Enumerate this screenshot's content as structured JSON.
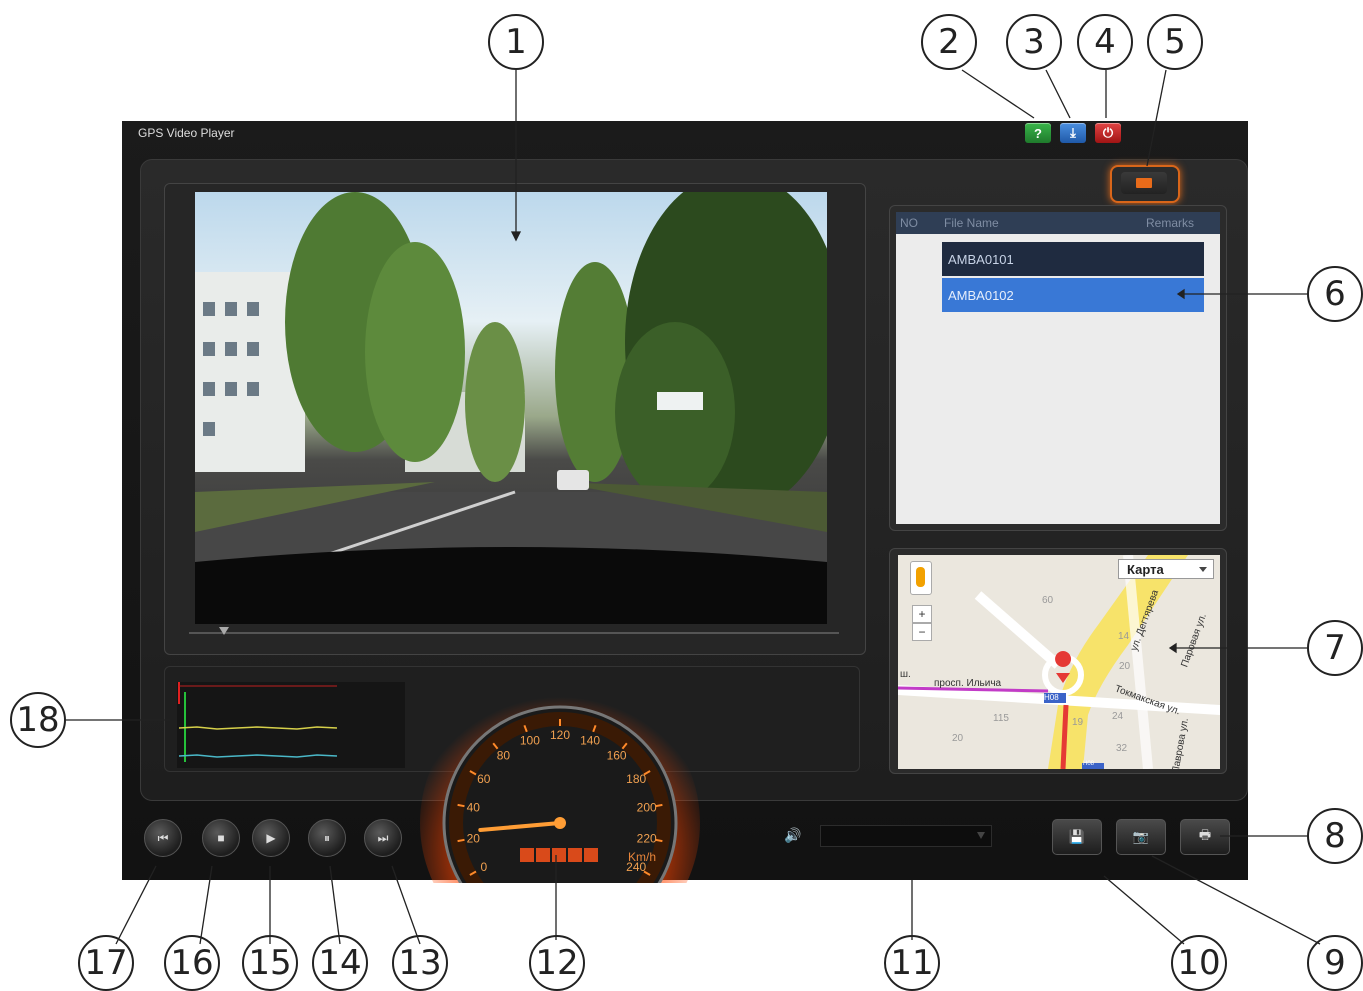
{
  "window": {
    "title": "GPS Video Player"
  },
  "window_buttons": {
    "help": "?",
    "download": "⤓",
    "power": "⏻"
  },
  "file_list": {
    "columns": [
      "NO",
      "File Name",
      "Remarks"
    ],
    "rows": [
      "AMBA0101",
      "AMBA0102"
    ],
    "selected_row": 1
  },
  "map": {
    "type_selector": "Карта",
    "zoom_in": "+",
    "zoom_out": "−",
    "labels": [
      "просп. Ильича",
      "Токмакская ул.",
      "ул. Дегтярева",
      "Лаврова ул.",
      "Паровая ул.",
      "ш."
    ],
    "numbers": [
      "115",
      "20",
      "19",
      "24",
      "32",
      "14",
      "20",
      "60"
    ],
    "route_badges": [
      "H08",
      "H08"
    ]
  },
  "speedometer": {
    "ticks": [
      "0",
      "20",
      "40",
      "60",
      "80",
      "100",
      "120",
      "140",
      "160",
      "180",
      "200",
      "220",
      "240"
    ],
    "unit": "Km/h",
    "speed_kmh": 25
  },
  "controls": {
    "first": "⏮",
    "stop": "■",
    "play": "▶",
    "pause": "⏸",
    "next": "⏭"
  },
  "tools": {
    "save": "💾",
    "snapshot": "📷",
    "print": "🖶"
  },
  "volume_icon": "🔊",
  "callouts": [
    "1",
    "2",
    "3",
    "4",
    "5",
    "6",
    "7",
    "8",
    "9",
    "10",
    "11",
    "12",
    "13",
    "14",
    "15",
    "16",
    "17",
    "18"
  ],
  "colors": {
    "accent": "#e36b1b",
    "selected_row": "#3978d6",
    "route": "#e53935"
  }
}
